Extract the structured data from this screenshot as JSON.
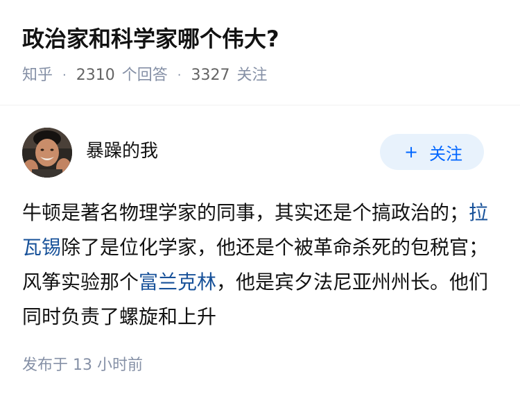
{
  "question": {
    "title": "政治家和科学家哪个伟大?",
    "source": "知乎",
    "answer_count": "2310",
    "answer_label": "个回答",
    "follow_count": "3327",
    "follow_label": "关注"
  },
  "answer": {
    "author": "暴躁的我",
    "follow_button": {
      "plus": "+",
      "label": "关注"
    },
    "content": [
      {
        "type": "text",
        "text": "牛顿是著名物理学家的同事，其实还是个搞政治的；"
      },
      {
        "type": "link",
        "text": "拉瓦锡"
      },
      {
        "type": "text",
        "text": "除了是位化学家，他还是个被革命杀死的包税官；风筝实验那个"
      },
      {
        "type": "link",
        "text": "富兰克林"
      },
      {
        "type": "text",
        "text": "，他是宾夕法尼亚州州长。他们同时负责了螺旋和上升"
      }
    ],
    "posted_label": "发布于",
    "posted_time": "13 小时前"
  },
  "colors": {
    "link": "#175199",
    "follow_bg": "#e8f2fc",
    "follow_text": "#0066ff",
    "meta": "#8590a6"
  }
}
